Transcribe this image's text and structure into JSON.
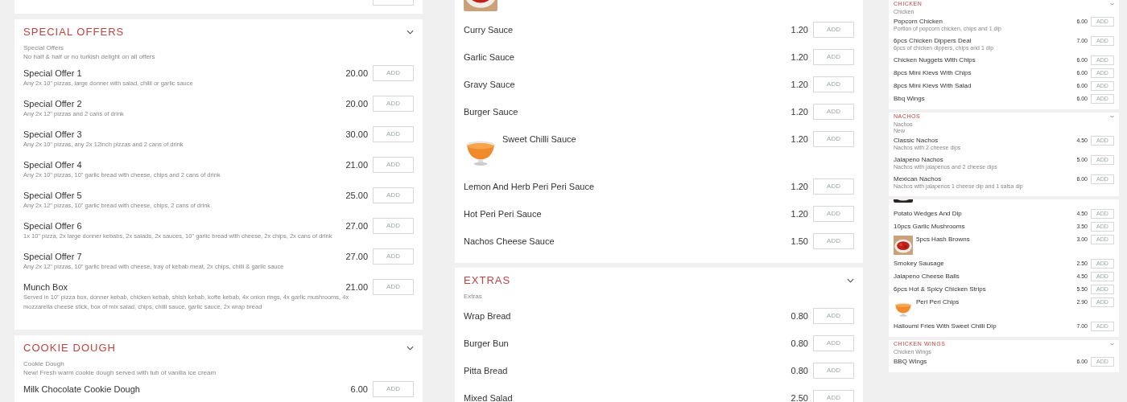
{
  "columns": [
    {
      "sections": [
        {
          "items": [
            {
              "kind": "button_sliver"
            }
          ]
        },
        {
          "title": "SPECIAL OFFERS",
          "expanded": true,
          "subtitle": [
            "Special Offers",
            "No half & half or no turkish delight on all offers"
          ],
          "items": [
            {
              "kind": "item",
              "name": "Special Offer 1",
              "description": "Any 2x 10\" pizzas, large donner with salad, chilli or garlic sauce",
              "price": "20.00",
              "button": "ADD"
            },
            {
              "kind": "item",
              "name": "Special Offer 2",
              "description": "Any 2x 12\" pizzas and 2 cans of drink",
              "price": "20.00",
              "button": "ADD"
            },
            {
              "kind": "item",
              "name": "Special Offer 3",
              "description": "Any 2x 10\" pizzas, any 2x 12inch pizzas and 2 cans of drink",
              "price": "30.00",
              "button": "ADD"
            },
            {
              "kind": "item",
              "name": "Special Offer 4",
              "description": "Any 2x 10\" pizzas, 10\" garlic bread with cheese, chips and 2 cans of drink",
              "price": "21.00",
              "button": "ADD"
            },
            {
              "kind": "item",
              "name": "Special Offer 5",
              "description": "Any 2x 12\" pizzas, 10\" garlic bread with cheese, chips, 2 cans of drink",
              "price": "25.00",
              "button": "ADD"
            },
            {
              "kind": "item",
              "name": "Special Offer 6",
              "description": "1x 10\" pizza, 2x large donner kebabs, 2x salads, 2x sauces, 10\" garlic bread with cheese, 2x chips, 2x cans of drink",
              "price": "27.00",
              "button": "ADD"
            },
            {
              "kind": "item",
              "name": "Special Offer 7",
              "description": "Any 2x 12\" pizzas, 10\" garlic bread with cheese, tray of kebab meat, 2x chips, chilli & garlic sauce",
              "price": "27.00",
              "button": "ADD"
            },
            {
              "kind": "item",
              "name": "Munch Box",
              "description": "Served in 10\" pizza box, donner kebab, chicken kebab, shish kebab, kofte kebab, 4x onion rings, 4x garlic mushrooms, 4x mozzarella cheese stick, box of mix salad, chips, chilli sauce, garlic sauce, 2x wrap bread",
              "price": "21.00",
              "button": "ADD"
            }
          ]
        },
        {
          "title": "COOKIE DOUGH",
          "expanded": true,
          "subtitle": [
            "Cookie Dough",
            "New! Fresh warm cookie dough served with tub of vanilla ice cream"
          ],
          "items": [
            {
              "kind": "item",
              "name": "Milk Chocolate Cookie Dough",
              "price": "6.00",
              "button": "ADD"
            }
          ]
        }
      ]
    },
    {
      "sections": [
        {
          "items": [
            {
              "kind": "image_sliver"
            },
            {
              "kind": "item",
              "name": "Curry Sauce",
              "price": "1.20",
              "button": "ADD"
            },
            {
              "kind": "item",
              "name": "Garlic Sauce",
              "price": "1.20",
              "button": "ADD"
            },
            {
              "kind": "item",
              "name": "Gravy Sauce",
              "price": "1.20",
              "button": "ADD"
            },
            {
              "kind": "item",
              "name": "Burger Sauce",
              "price": "1.20",
              "button": "ADD"
            },
            {
              "kind": "item",
              "name": "Sweet Chilli Sauce",
              "price": "1.20",
              "button": "ADD"
            },
            {
              "kind": "item",
              "name": "Lemon And Herb Peri Peri Sauce",
              "price": "1.20",
              "button": "ADD"
            },
            {
              "kind": "item",
              "name": "Hot Peri Peri Sauce",
              "price": "1.20",
              "button": "ADD"
            },
            {
              "kind": "item",
              "name": "Nachos Cheese Sauce",
              "price": "1.50",
              "button": "ADD"
            }
          ]
        },
        {
          "title": "EXTRAS",
          "expanded": true,
          "subtitle": [
            "Extras"
          ],
          "items": [
            {
              "kind": "item",
              "name": "Wrap Bread",
              "price": "0.80",
              "button": "ADD"
            },
            {
              "kind": "item",
              "name": "Burger Bun",
              "price": "0.80",
              "button": "ADD"
            },
            {
              "kind": "item",
              "name": "Pitta Bread",
              "price": "0.80",
              "button": "ADD"
            },
            {
              "kind": "item",
              "name": "Mixed Salad",
              "price": "2.50",
              "button": "ADD"
            }
          ]
        }
      ]
    },
    {
      "sections": [
        {
          "title": "CHICKEN",
          "expanded": true,
          "subtitle": [
            "Chicken"
          ],
          "items": [
            {
              "kind": "item",
              "name": "Popcorn Chicken",
              "description": "Portion of popcorn chicken, chips and 1 dip",
              "price": "6.00",
              "button": "ADD"
            },
            {
              "kind": "item",
              "name": "6pcs Chicken Dippers Deal",
              "description": "6pcs of chicken dippers, chips and 1 dip",
              "price": "7.00",
              "button": "ADD"
            },
            {
              "kind": "item",
              "name": "Chicken Nuggets With Chips",
              "price": "6.00",
              "button": "ADD"
            },
            {
              "kind": "item",
              "name": "8pcs Mini Kievs With Chips",
              "price": "6.00",
              "button": "ADD"
            },
            {
              "kind": "item",
              "name": "8pcs Mini Kievs With Salad",
              "price": "6.00",
              "button": "ADD"
            },
            {
              "kind": "item",
              "name": "Bbq Wings",
              "price": "6.00",
              "button": "ADD"
            }
          ]
        },
        {
          "title": "NACHOS",
          "expanded": true,
          "subtitle": [
            "Nachos",
            "New"
          ],
          "items": [
            {
              "kind": "item",
              "name": "Classic Nachos",
              "description": "Nachos with 2 cheese dips",
              "price": "4.50",
              "button": "ADD"
            },
            {
              "kind": "item",
              "name": "Jalapeno Nachos",
              "description": "Nachos with jalapenos and 2 cheese dips",
              "price": "5.00",
              "button": "ADD"
            },
            {
              "kind": "item",
              "name": "Mexican Nachos",
              "description": "Nachos with jalapenos 1 cheese dip and 1 salsa dip",
              "price": "6.00",
              "button": "ADD"
            }
          ]
        },
        {
          "items": [
            {
              "kind": "image_sliver"
            },
            {
              "kind": "item",
              "name": "Potato Wedges And Dip",
              "price": "4.50",
              "button": "ADD"
            },
            {
              "kind": "item",
              "name": "10pcs Garlic Mushrooms",
              "price": "3.50",
              "button": "ADD"
            },
            {
              "kind": "item",
              "name": "5pcs Hash Browns",
              "price": "3.00",
              "button": "ADD"
            },
            {
              "kind": "item",
              "name": "Smokey Sausage",
              "price": "2.50",
              "button": "ADD"
            },
            {
              "kind": "item",
              "name": "Jalapeno Cheese Balls",
              "price": "4.50",
              "button": "ADD"
            },
            {
              "kind": "item",
              "name": "6pcs Hot & Spicy Chicken Strips",
              "price": "5.50",
              "button": "ADD"
            },
            {
              "kind": "item",
              "name": "Peri Peri Chips",
              "price": "2.90",
              "button": "ADD"
            },
            {
              "kind": "item",
              "name": "Halloumi Fries With Sweet Chilli Dip",
              "price": "7.00",
              "button": "ADD"
            }
          ]
        },
        {
          "title": "CHICKEN WINGS",
          "expanded": true,
          "subtitle": [
            "Chicken Wings"
          ],
          "items": [
            {
              "kind": "item",
              "name": "BBQ Wings",
              "price": "6.00",
              "button": "ADD"
            }
          ]
        }
      ]
    }
  ]
}
